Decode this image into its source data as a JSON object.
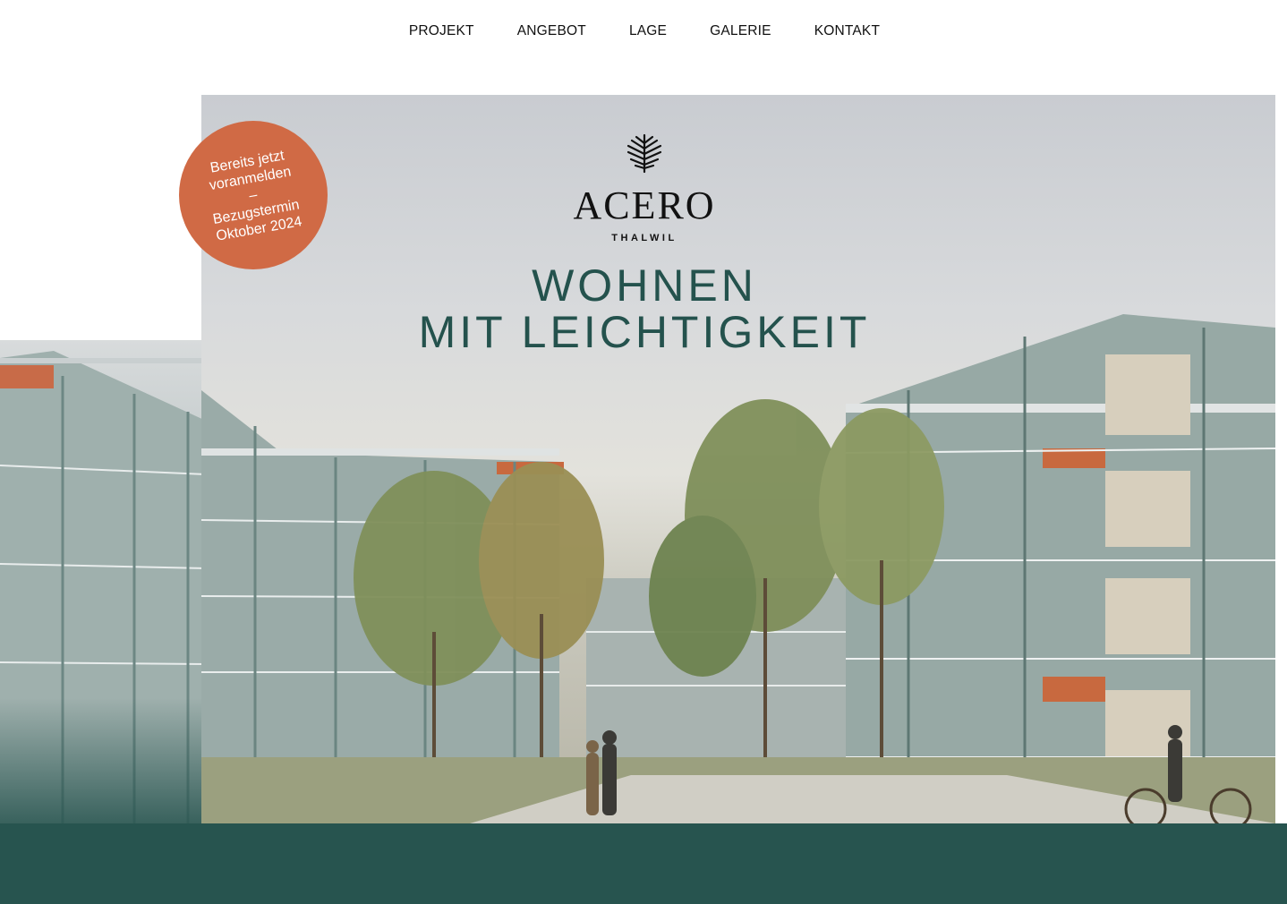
{
  "nav": {
    "items": [
      "PROJEKT",
      "ANGEBOT",
      "LAGE",
      "GALERIE",
      "KONTAKT"
    ]
  },
  "logo": {
    "wordmark": "ACERO",
    "location": "THALWIL"
  },
  "headline": {
    "line1": "WOHNEN",
    "line2": "MIT LEICHTIGKEIT"
  },
  "badge": {
    "line1": "Bereits jetzt",
    "line2": "voranmelden",
    "separator": "–",
    "line3": "Bezugstermin",
    "line4": "Oktober 2024"
  },
  "colors": {
    "accent_green": "#24524d",
    "badge_orange": "#d06a45",
    "band_green": "#27544f"
  },
  "icons": [
    "tree-logo-icon"
  ]
}
